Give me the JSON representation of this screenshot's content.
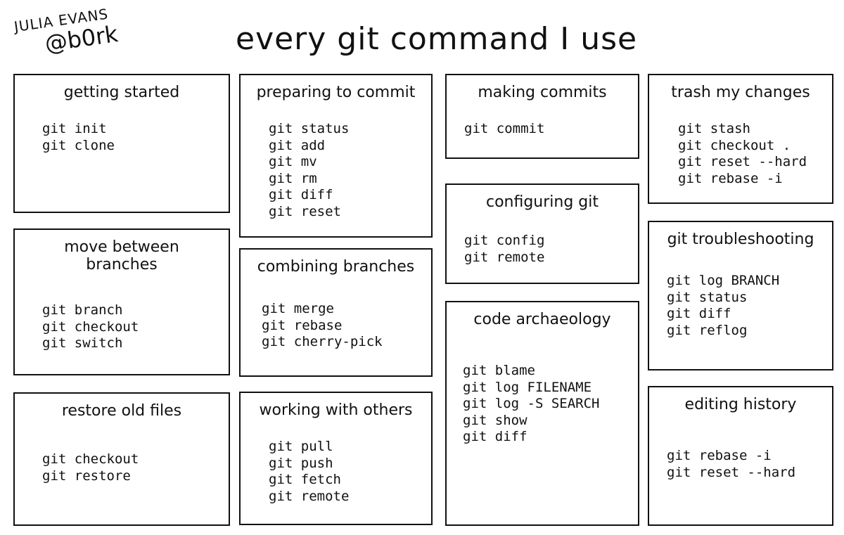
{
  "author": {
    "name": "JULIA EVANS",
    "handle": "@b0rk"
  },
  "title": "every git command I use",
  "boxes": [
    {
      "id": "getting-started",
      "title": "getting started",
      "commands": [
        "git init",
        "git clone"
      ]
    },
    {
      "id": "move-between-branches",
      "title": "move between branches",
      "commands": [
        "git branch",
        "git checkout",
        "git switch"
      ]
    },
    {
      "id": "restore-old-files",
      "title": "restore old files",
      "commands": [
        "git checkout",
        "git restore"
      ]
    },
    {
      "id": "preparing-to-commit",
      "title": "preparing to commit",
      "commands": [
        "git status",
        "git add",
        "git mv",
        "git rm",
        "git diff",
        "git reset"
      ]
    },
    {
      "id": "combining-branches",
      "title": "combining branches",
      "commands": [
        "git merge",
        "git rebase",
        "git cherry-pick"
      ]
    },
    {
      "id": "working-with-others",
      "title": "working with others",
      "commands": [
        "git pull",
        "git push",
        "git fetch",
        "git remote"
      ]
    },
    {
      "id": "making-commits",
      "title": "making commits",
      "commands": [
        "git commit"
      ]
    },
    {
      "id": "configuring-git",
      "title": "configuring git",
      "commands": [
        "git config",
        "git remote"
      ]
    },
    {
      "id": "code-archaeology",
      "title": "code archaeology",
      "commands": [
        "git blame",
        "git log FILENAME",
        "git log -S SEARCH",
        "git show",
        "git diff"
      ]
    },
    {
      "id": "trash-my-changes",
      "title": "trash my changes",
      "commands": [
        "git stash",
        "git checkout .",
        "git reset --hard",
        "git rebase -i"
      ]
    },
    {
      "id": "git-troubleshooting",
      "title": "git troubleshooting",
      "commands": [
        "git log BRANCH",
        "git status",
        "git diff",
        "git reflog"
      ]
    },
    {
      "id": "editing-history",
      "title": "editing history",
      "commands": [
        "git rebase -i",
        "git reset --hard"
      ]
    }
  ]
}
